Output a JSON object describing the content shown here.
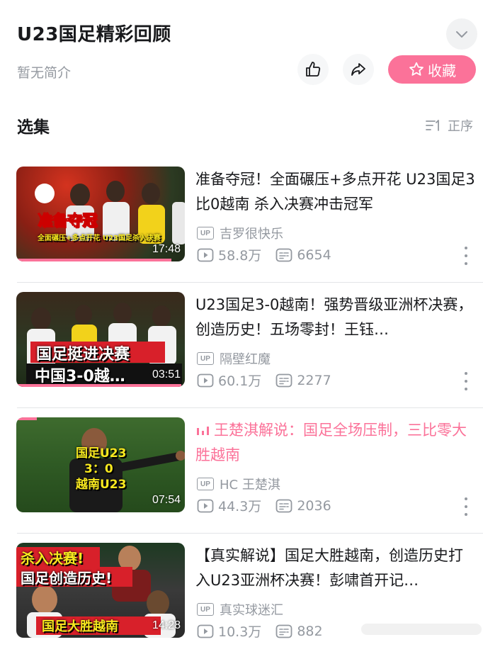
{
  "header": {
    "title": "U23国足精彩回顾",
    "intro": "暂无简介",
    "favorite_label": "收藏"
  },
  "section": {
    "title": "选集",
    "sort_label": "正序"
  },
  "colors": {
    "accent": "#fb7299",
    "text_primary": "#18191c",
    "text_secondary": "#9499a0"
  },
  "episodes": [
    {
      "title": "准备夺冠！全面碾压+多点开花 U23国足3比0越南 杀入决赛冲击冠军",
      "uploader": "吉罗很快乐",
      "views": "58.8万",
      "danmaku": "6654",
      "duration": "17:48",
      "thumb_caption_main": "准备夺冠",
      "thumb_caption_sub": "全面碾压+多点开花 U23国足杀入决赛",
      "watched_fraction": 0.92,
      "playing": false
    },
    {
      "title": "U23国足3-0越南！强势晋级亚洲杯决赛，创造历史！五场零封！王钰…",
      "uploader": "隔壁红魔",
      "views": "60.1万",
      "danmaku": "2277",
      "duration": "03:51",
      "thumb_caption_main": "国足挺进决赛",
      "thumb_caption_sub": "中国3-0越…",
      "watched_fraction": 0.98,
      "playing": false
    },
    {
      "title": "王楚淇解说：国足全场压制，三比零大胜越南",
      "uploader": "HC 王楚淇",
      "views": "44.3万",
      "danmaku": "2036",
      "duration": "07:54",
      "thumb_caption_main": "国足U23",
      "thumb_caption_score": "3：0",
      "thumb_caption_sub": "越南U23",
      "watched_fraction": 0.12,
      "playing": true
    },
    {
      "title": "【真实解说】国足大胜越南，创造历史打入U23亚洲杯决赛！彭啸首开记…",
      "uploader": "真实球迷汇",
      "views": "10.3万",
      "danmaku": "882",
      "duration": "14:28",
      "thumb_caption_main": "杀入决赛!",
      "thumb_caption_mid": "国足创造历史!",
      "thumb_caption_sub": "国足大胜越南",
      "watched_fraction": 0,
      "playing": false
    }
  ],
  "icons": {
    "collapse": "chevron-down-icon",
    "like": "thumb-up-icon",
    "share": "share-icon",
    "favorite": "star-icon",
    "sort": "sort-icon",
    "uploader": "up-badge-icon",
    "views": "play-count-icon",
    "danmaku": "danmaku-icon",
    "more": "more-vertical-icon",
    "playing": "playing-bars-icon"
  }
}
